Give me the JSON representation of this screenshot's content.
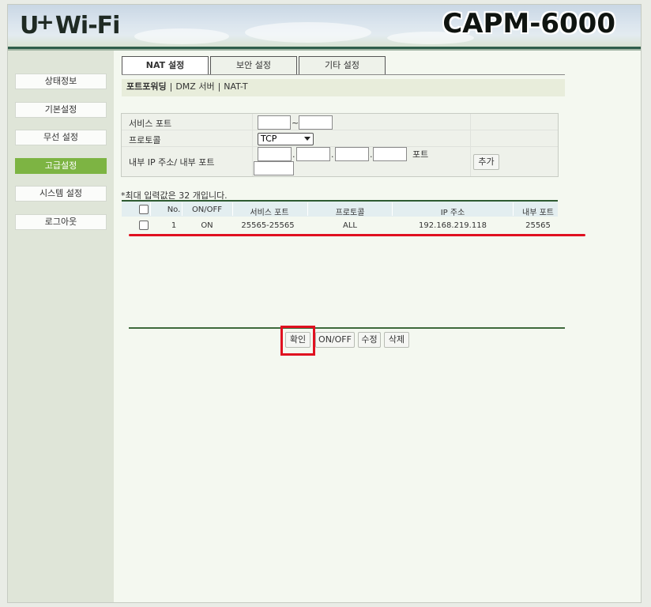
{
  "header": {
    "logo_text": "U",
    "logo_plus": "+",
    "logo_wifi": "Wi-Fi",
    "model": "CAPM-6000"
  },
  "sidebar": {
    "items": [
      {
        "label": "상태정보"
      },
      {
        "label": "기본설정"
      },
      {
        "label": "무선 설정"
      },
      {
        "label": "고급설정"
      },
      {
        "label": "시스템 설정"
      },
      {
        "label": "로그아웃"
      }
    ]
  },
  "tabs": [
    {
      "label": "NAT 설정"
    },
    {
      "label": "보안 설정"
    },
    {
      "label": "기타 설정"
    }
  ],
  "subnav": {
    "items": [
      "포트포워딩",
      "DMZ 서버",
      "NAT-T"
    ],
    "separator": "|"
  },
  "form": {
    "service_port_label": "서비스 포트",
    "service_port_sep": "~",
    "service_port_from": "",
    "service_port_to": "",
    "protocol_label": "프로토콜",
    "protocol_value": "TCP",
    "ip_port_label": "내부 IP 주소/ 내부 포트",
    "ip_dot": ".",
    "port_suffix": "포트",
    "add_button": "추가"
  },
  "max_note": "*최대 입력값은 32 개입니다.",
  "table": {
    "headers": [
      "No.",
      "ON/OFF",
      "서비스 포트",
      "프로토콜",
      "IP 주소",
      "내부 포트"
    ],
    "rows": [
      {
        "no": "1",
        "onoff": "ON",
        "service_port": "25565-25565",
        "protocol": "ALL",
        "ip": "192.168.219.118",
        "internal_port": "25565"
      }
    ]
  },
  "actions": {
    "confirm": "확인",
    "onoff": "ON/OFF",
    "edit": "수정",
    "delete": "삭제"
  },
  "colors": {
    "active_green": "#7db443",
    "highlight_red": "#e01020",
    "header_line": "#2f5e4b"
  }
}
